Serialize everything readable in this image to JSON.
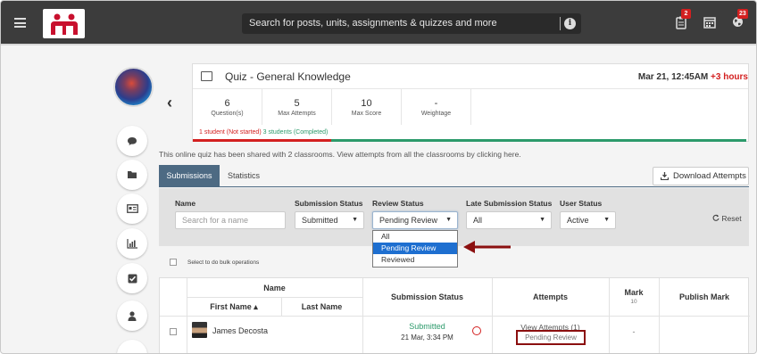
{
  "topbar": {
    "search_placeholder": "Search for posts, units, assignments & quizzes and more",
    "info_glyph": "i",
    "icons": [
      "menu-icon",
      "logo",
      "info-icon",
      "clipboard-icon",
      "calendar-icon",
      "globe-icon"
    ],
    "badges": {
      "assignments": "2",
      "notifications": "23"
    }
  },
  "back_glyph": "‹",
  "quiz": {
    "title": "Quiz - General Knowledge",
    "date": "Mar 21, 12:45AM",
    "extra_hours": "+3 hours",
    "stats": [
      {
        "value": "6",
        "label": "Question(s)"
      },
      {
        "value": "5",
        "label": "Max Attempts"
      },
      {
        "value": "10",
        "label": "Max Score"
      },
      {
        "value": "-",
        "label": "Weightage"
      }
    ],
    "not_started": "1 student (Not started)",
    "completed": "3 students (Completed)",
    "not_started_fraction": 0.25,
    "completed_fraction": 0.75
  },
  "shared_text": "This online quiz has been shared with 2 classrooms. View attempts from all the classrooms by",
  "shared_link": "clicking here.",
  "tabs": {
    "submissions": "Submissions",
    "statistics": "Statistics"
  },
  "download_label": "Download Attempts",
  "filters": {
    "name_label": "Name",
    "name_placeholder": "Search for a name",
    "submission_status_label": "Submission Status",
    "submission_status_value": "Submitted",
    "review_status_label": "Review Status",
    "review_status_value": "Pending Review",
    "late_label": "Late Submission Status",
    "late_value": "All",
    "user_status_label": "User Status",
    "user_status_value": "Active",
    "reset_label": "Reset",
    "dropdown_arrow": "▼"
  },
  "review_options": [
    "All",
    "Pending Review",
    "Reviewed"
  ],
  "review_selected_index": 1,
  "bulk_label": "Select to do bulk operations",
  "table": {
    "name_header": "Name",
    "first_name_header": "First Name ▴",
    "last_name_header": "Last Name",
    "submission_status_header": "Submission Status",
    "attempts_header": "Attempts",
    "mark_header": "Mark",
    "mark_sub": "10",
    "publish_header": "Publish Mark",
    "rows": [
      {
        "first_name": "James Decosta",
        "status": "Submitted",
        "date": "21 Mar, 3:34 PM",
        "attempts_link": "View Attempts (1)",
        "review": "Pending Review",
        "mark": "-"
      }
    ]
  },
  "colors": {
    "topbar": "#3c3c3c",
    "accent_tab": "#4d6a83",
    "red": "#d32020",
    "green": "#2c9a6b",
    "selected_option": "#1e6fd0",
    "annotation": "#8b0f0f"
  }
}
